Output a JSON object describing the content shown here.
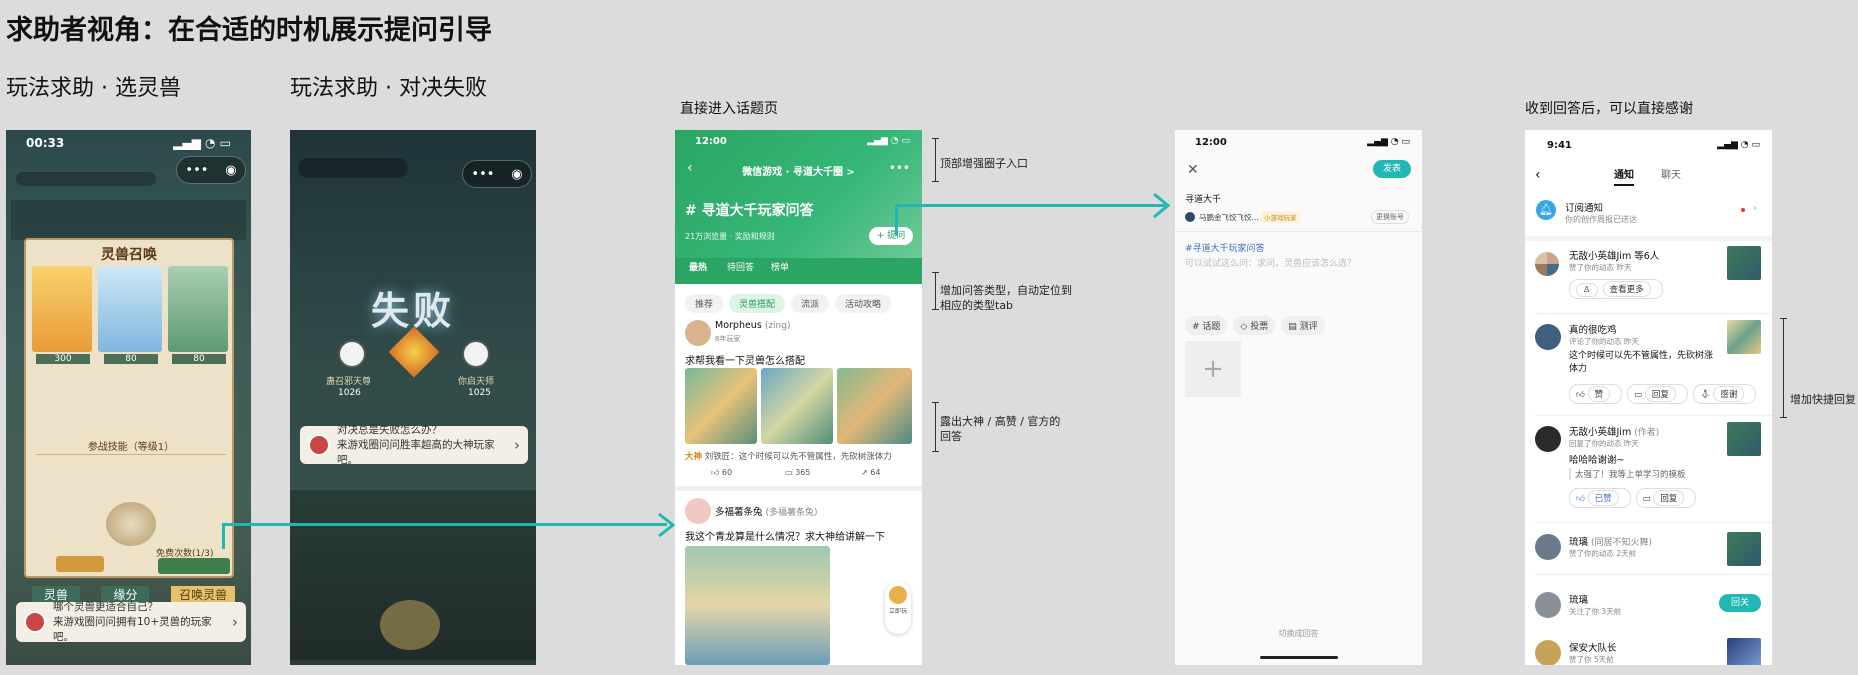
{
  "page": {
    "title": "求助者视角：在合适的时机展示提问引导",
    "label_select_pet": "玩法求助 · 选灵兽",
    "label_duel_fail": "玩法求助 · 对决失败",
    "label_topic": "直接进入话题页",
    "label_thanks": "收到回答后，可以直接感谢"
  },
  "screen1": {
    "time": "00:33",
    "panel_title": "灵兽召唤",
    "pet_names": [
      "",
      "青云",
      "山魈"
    ],
    "pet_costs": [
      "300",
      "80",
      "80"
    ],
    "skill_title": "参战技能（等级1）",
    "free_text": "免费次数(1/3)",
    "bottom_tabs": [
      "灵兽",
      "缘分",
      "召唤灵兽"
    ],
    "tip_line1": "哪个灵兽更适合自己？",
    "tip_line2": "来游戏圈问问拥有10+灵兽的玩家吧。"
  },
  "screen2": {
    "fail_text": "失败",
    "left_player": "蛊召邪天尊",
    "left_score": "1026",
    "right_player": "你启天师",
    "right_score": "1025",
    "tip_line1": "对决总是失败怎么办？",
    "tip_line2": "来游戏圈问问胜率超高的大神玩家吧。"
  },
  "screen3": {
    "time": "12:00",
    "nav_title": "微信游戏 · 寻道大千圈 >",
    "topic_title": "# 寻道大千玩家问答",
    "topic_meta": "21万浏览量 · 奖励和规则",
    "ask_button": "+ 提问",
    "tabs": [
      "最热",
      "待回答",
      "榜单"
    ],
    "categories": [
      "推荐",
      "灵兽搭配",
      "流派",
      "活动攻略"
    ],
    "post1_author": "Morpheus",
    "post1_author_tag": "(zing)",
    "post1_sub": "8年玩家",
    "post1_text": "求帮我看一下灵兽怎么搭配",
    "answer_badge": "大神",
    "answer_text": "刘铁匠：这个时候可以先不管属性，先砍树涨体力",
    "post1_likes": "60",
    "post1_comments": "365",
    "post1_shares": "64",
    "post2_author": "多福薯条兔",
    "post2_author_tag": "(多福薯条兔)",
    "post2_text": "我这个青龙算是什么情况？求大神给讲解一下",
    "float_label": "立即玩"
  },
  "notes": {
    "n1": "顶部增强圈子入口",
    "n2_l1": "增加问答类型，自动定位到",
    "n2_l2": "相应的类型tab",
    "n3_l1": "露出大神 / 高赞 / 官方的",
    "n3_l2": "回答",
    "n4": "增加快捷回复"
  },
  "screen4": {
    "time": "12:00",
    "publish": "发表",
    "circle": "寻道大千",
    "user": "马鹏金飞饺飞饺...",
    "user_badge": "小游戏玩家",
    "change_account": "更换账号",
    "topic_tag": "#寻道大千玩家问答",
    "placeholder": "可以试试这么问：求问，灵兽应该怎么选？",
    "chips": [
      "# 话题",
      "◇ 投票",
      "▤ 测评"
    ],
    "switch_text": "切换成回答"
  },
  "screen5": {
    "time": "9:41",
    "tabs": [
      "通知",
      "聊天"
    ],
    "sub_title": "订阅通知",
    "sub_desc": "你的创作周报已送达",
    "rows": [
      {
        "name": "无敌小英雄Jim 等6人",
        "action": "赞了你的动态",
        "time": "昨天",
        "extra": "查看更多"
      },
      {
        "name": "真的很吃鸡",
        "action": "评论了你的动态",
        "time": "昨天",
        "text": "这个时候可以先不管属性，先砍树涨体力",
        "b1": "赞",
        "b2": "回复",
        "b3": "感谢"
      },
      {
        "name": "无敌小英雄Jim",
        "tag": "(作者)",
        "action": "回复了你的动态",
        "time": "昨天",
        "text": "哈哈哈谢谢~",
        "quote": "太强了！我等上单学习的模板",
        "b1": "已赞",
        "b2": "回复"
      },
      {
        "name": "琉璃",
        "tag": "(同居不知火舞)",
        "action": "赞了你的动态",
        "time": "2天前"
      },
      {
        "name": "琉璃",
        "action": "关注了你",
        "time": "3天前",
        "follow": "回关"
      },
      {
        "name": "保安大队长",
        "action": "赞了你",
        "time": "5天前"
      }
    ]
  },
  "colors": {
    "accent": "#1fb8b3",
    "topic_green": "#2aa564",
    "wechat_green": "#07c160"
  }
}
